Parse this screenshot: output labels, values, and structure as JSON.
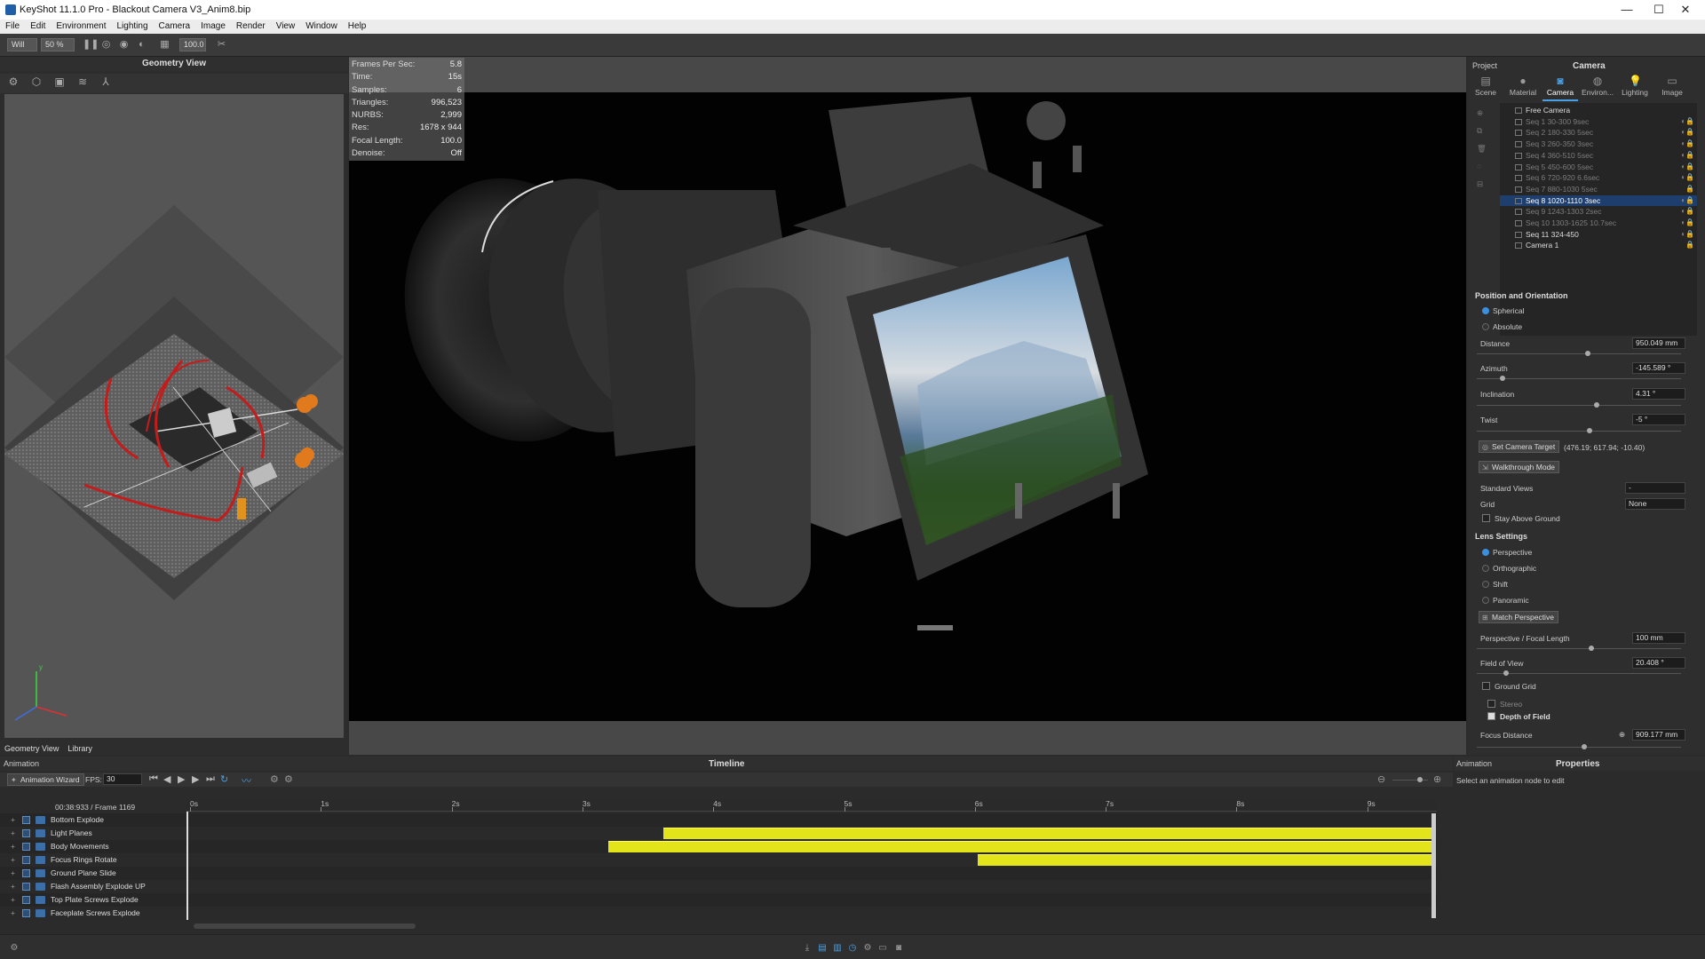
{
  "window": {
    "title": "KeyShot 11.1.0 Pro - Blackout Camera V3_Anim8.bip",
    "minimize": "—",
    "maximize": "☐",
    "close": "✕"
  },
  "menu": [
    "File",
    "Edit",
    "Environment",
    "Lighting",
    "Camera",
    "Image",
    "Render",
    "View",
    "Window",
    "Help"
  ],
  "toolbar": {
    "workspace": "Will",
    "zoom": "50 %",
    "value": "100.0"
  },
  "geometry_view": {
    "title": "Geometry View",
    "tabs": [
      "Geometry View",
      "Library"
    ],
    "axis_y": "y"
  },
  "stats": [
    {
      "label": "Frames Per Sec:",
      "value": "5.8"
    },
    {
      "label": "Time:",
      "value": "15s"
    },
    {
      "label": "Samples:",
      "value": "6"
    },
    {
      "label": "Triangles:",
      "value": "996,523"
    },
    {
      "label": "NURBS:",
      "value": "2,999"
    },
    {
      "label": "Res:",
      "value": "1678 x 944"
    },
    {
      "label": "Focal Length:",
      "value": "100.0"
    },
    {
      "label": "Denoise:",
      "value": "Off"
    }
  ],
  "right_panel": {
    "project_label": "Project",
    "title": "Camera",
    "tabs": [
      {
        "label": "Scene",
        "icon": "scene-icon",
        "active": false
      },
      {
        "label": "Material",
        "icon": "material-icon",
        "active": false
      },
      {
        "label": "Camera",
        "icon": "camera-icon",
        "active": true
      },
      {
        "label": "Environ...",
        "icon": "environment-icon",
        "active": false
      },
      {
        "label": "Lighting",
        "icon": "lighting-icon",
        "active": false
      },
      {
        "label": "Image",
        "icon": "image-icon",
        "active": false
      }
    ],
    "cameras": [
      {
        "name": "Free Camera",
        "state": "white",
        "locked": false
      },
      {
        "name": "Seq 1 30-300 9sec",
        "state": "dim",
        "locked": true
      },
      {
        "name": "Seq 2 180-330 5sec",
        "state": "dim",
        "locked": true
      },
      {
        "name": "Seq 3 260-350 3sec",
        "state": "dim",
        "locked": true
      },
      {
        "name": "Seq 4 360-510 5sec",
        "state": "dim",
        "locked": true
      },
      {
        "name": "Seq 5 450-600 5sec",
        "state": "dim",
        "locked": true
      },
      {
        "name": "Seq 6 720-920 6.6sec",
        "state": "dim",
        "locked": true
      },
      {
        "name": "Seq 7 880-1030 5sec",
        "state": "dim",
        "locked": true
      },
      {
        "name": "Seq 8 1020-1110 3sec",
        "state": "sel",
        "locked": true
      },
      {
        "name": "Seq 9 1243-1303 2sec",
        "state": "dim",
        "locked": true
      },
      {
        "name": "Seq 10 1303-1625 10.7sec",
        "state": "dim",
        "locked": true
      },
      {
        "name": "Seq 11 324-450",
        "state": "white",
        "locked": true
      },
      {
        "name": "Camera 1",
        "state": "white",
        "locked": true
      }
    ],
    "position": {
      "section": "Position and Orientation",
      "spherical": "Spherical",
      "absolute": "Absolute",
      "distance_label": "Distance",
      "distance": "950.049 mm",
      "azimuth_label": "Azimuth",
      "azimuth": "-145.589 °",
      "inclination_label": "Inclination",
      "inclination": "4.31 °",
      "twist_label": "Twist",
      "twist": "-5 °",
      "set_target": "Set Camera Target",
      "target_coords": "(476.19; 617.94; -10.40)",
      "walkthrough": "Walkthrough Mode",
      "standard_views": "Standard Views",
      "standard_views_value": "-",
      "grid": "Grid",
      "grid_value": "None",
      "stay_above": "Stay Above Ground"
    },
    "lens": {
      "section": "Lens Settings",
      "perspective": "Perspective",
      "orthographic": "Orthographic",
      "shift": "Shift",
      "panoramic": "Panoramic",
      "match": "Match Perspective",
      "focal_label": "Perspective / Focal Length",
      "focal": "100 mm",
      "fov_label": "Field of View",
      "fov": "20.408 °",
      "ground_grid": "Ground Grid",
      "stereo": "Stereo",
      "dof": "Depth of Field",
      "focus_label": "Focus Distance",
      "focus": "909.177 mm"
    }
  },
  "animation": {
    "panel": "Animation",
    "title": "Timeline",
    "wizard": "Animation Wizard",
    "fps_label": "FPS:",
    "fps": "30",
    "time": "00:38:933 / Frame 1169",
    "ticks": [
      "0s",
      "1s",
      "2s",
      "3s",
      "4s",
      "5s",
      "6s",
      "7s",
      "8s",
      "9s"
    ],
    "tracks": [
      {
        "name": "Bottom Explode",
        "start": null,
        "end": null
      },
      {
        "name": "Light Planes",
        "start": 3.62,
        "end": 9.5
      },
      {
        "name": "Body Movements",
        "start": 3.2,
        "end": 9.5
      },
      {
        "name": "Focus Rings Rotate",
        "start": 6.02,
        "end": 9.5
      },
      {
        "name": "Ground Plane Slide",
        "start": null,
        "end": null
      },
      {
        "name": "Flash Assembly Explode UP",
        "start": null,
        "end": null
      },
      {
        "name": "Top Plate Screws Explode",
        "start": null,
        "end": null
      },
      {
        "name": "Faceplate Screws Explode",
        "start": null,
        "end": null
      }
    ]
  },
  "properties": {
    "tab": "Animation",
    "title": "Properties",
    "hint": "Select an animation node to edit"
  }
}
